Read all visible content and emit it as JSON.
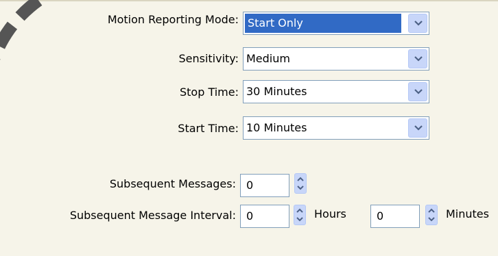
{
  "fields": {
    "motion_mode": {
      "label": "Motion Reporting Mode:",
      "value": "Start Only"
    },
    "sensitivity": {
      "label": "Sensitivity:",
      "value": "Medium"
    },
    "stop_time": {
      "label": "Stop Time:",
      "value": "30 Minutes"
    },
    "start_time": {
      "label": "Start Time:",
      "value": "10 Minutes"
    },
    "subsequent_messages": {
      "label": "Subsequent Messages:",
      "value": "0"
    },
    "interval": {
      "label": "Subsequent Message Interval:",
      "hours_value": "0",
      "hours_unit": "Hours",
      "minutes_value": "0",
      "minutes_unit": "Minutes"
    }
  },
  "colors": {
    "background": "#f6f4e9",
    "selection": "#316ac5",
    "border": "#7f9db9",
    "button": "#c8d6f9"
  },
  "icons": {
    "dropdown": "chevron-down-icon",
    "spinner": "spinner-arrows-icon"
  }
}
